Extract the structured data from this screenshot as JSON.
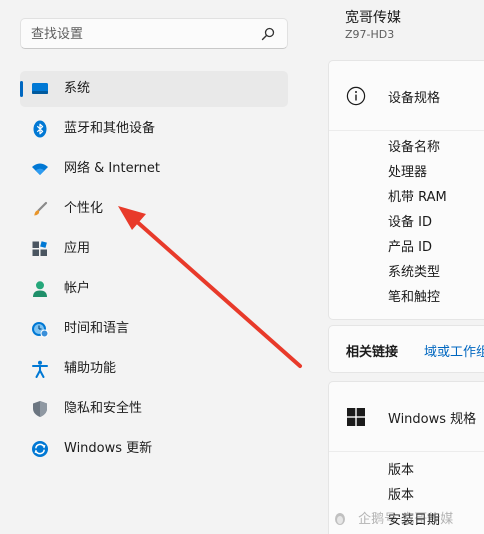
{
  "search": {
    "placeholder": "查找设置"
  },
  "sidebar": {
    "items": [
      {
        "label": "系统",
        "icon": "monitor-icon"
      },
      {
        "label": "蓝牙和其他设备",
        "icon": "bluetooth-icon"
      },
      {
        "label": "网络 & Internet",
        "icon": "wifi-icon"
      },
      {
        "label": "个性化",
        "icon": "paintbrush-icon"
      },
      {
        "label": "应用",
        "icon": "apps-icon"
      },
      {
        "label": "帐户",
        "icon": "account-icon"
      },
      {
        "label": "时间和语言",
        "icon": "clock-globe-icon"
      },
      {
        "label": "辅助功能",
        "icon": "accessibility-icon"
      },
      {
        "label": "隐私和安全性",
        "icon": "shield-icon"
      },
      {
        "label": "Windows 更新",
        "icon": "update-icon"
      }
    ],
    "selected_index": 0
  },
  "device": {
    "name": "宽哥传媒",
    "model": "Z97-HD3"
  },
  "specs": {
    "title": "设备规格",
    "rows": [
      "设备名称",
      "处理器",
      "机带 RAM",
      "设备 ID",
      "产品 ID",
      "系统类型",
      "笔和触控"
    ]
  },
  "links": {
    "title": "相关链接",
    "link": "域或工作组"
  },
  "windows_specs": {
    "title": "Windows 规格",
    "rows": [
      "版本",
      "版本",
      "安装日期"
    ]
  },
  "watermark": {
    "text": "企鹅号 宽哥传媒"
  },
  "colors": {
    "accent": "#0067c0",
    "arrow": "#e83a2a",
    "background": "#f3f3f3",
    "card": "#fbfbfb"
  }
}
